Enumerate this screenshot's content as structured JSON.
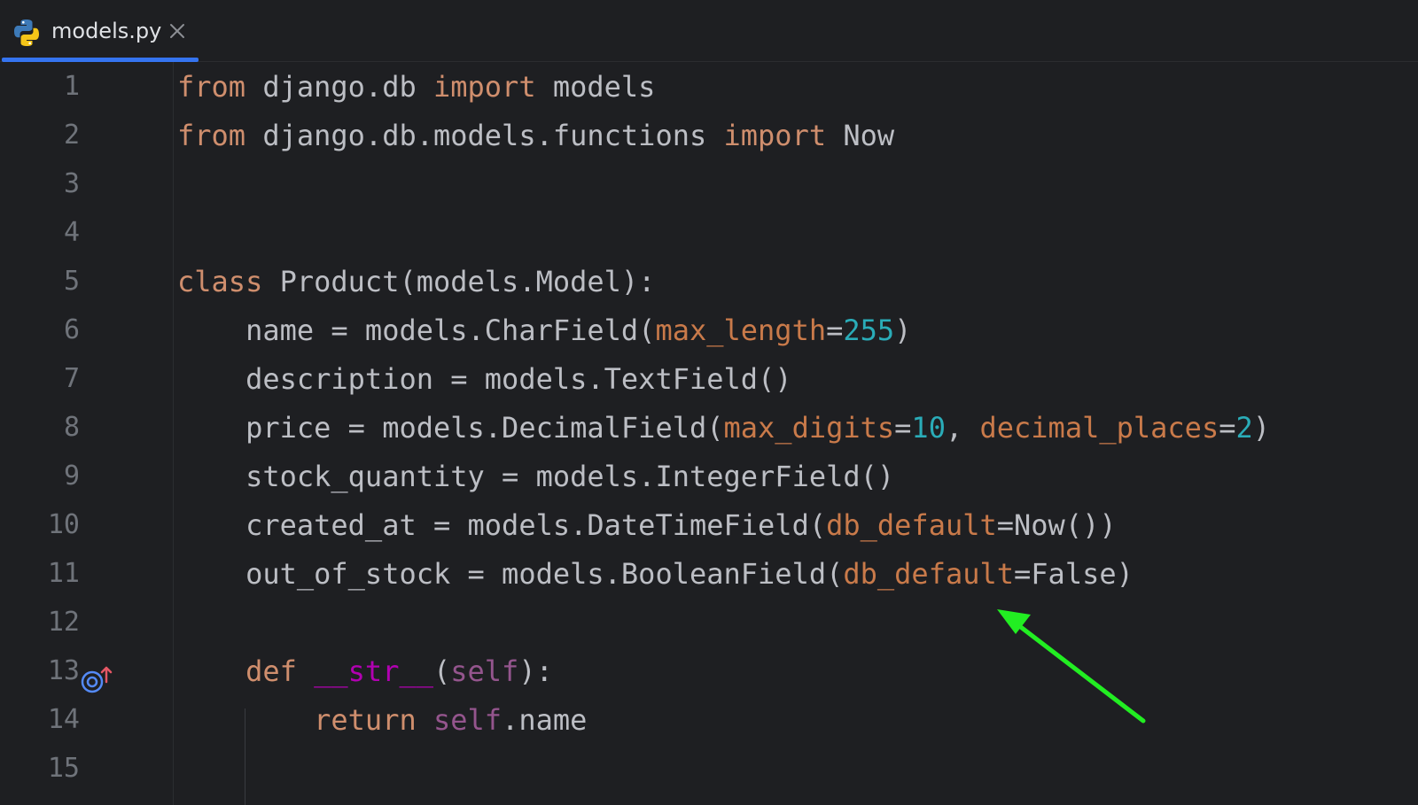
{
  "tab": {
    "filename": "models.py",
    "icon": "python-file-icon",
    "close_icon": "close-icon",
    "accent_color": "#3574f0"
  },
  "editor": {
    "line_numbers": [
      "1",
      "2",
      "3",
      "4",
      "5",
      "6",
      "7",
      "8",
      "9",
      "10",
      "11",
      "12",
      "13",
      "14",
      "15"
    ],
    "colors": {
      "background": "#1e1f22",
      "keyword": "#cf8e6d",
      "parameter": "#c97a4a",
      "number": "#2aacb8",
      "text": "#bcbec4",
      "dunder": "#b200b2",
      "self": "#94558d",
      "annotation_arrow": "#22ee22"
    },
    "lines": {
      "l1": {
        "kw1": "from",
        "t1": " django.db ",
        "kw2": "import",
        "t2": " models"
      },
      "l2": {
        "kw1": "from",
        "t1": " django.db.models.functions ",
        "kw2": "import",
        "t2": " Now"
      },
      "l5": {
        "kw1": "class",
        "t1": " Product(models.Model):"
      },
      "l6": {
        "t1": "    name = models.CharField(",
        "p1": "max_length",
        "t2": "=",
        "n1": "255",
        "t3": ")"
      },
      "l7": {
        "t1": "    description = models.TextField()"
      },
      "l8": {
        "t1": "    price = models.DecimalField(",
        "p1": "max_digits",
        "t2": "=",
        "n1": "10",
        "t3": ", ",
        "p2": "decimal_places",
        "t4": "=",
        "n2": "2",
        "t5": ")"
      },
      "l9": {
        "t1": "    stock_quantity = models.IntegerField()"
      },
      "l10": {
        "t1": "    created_at = models.DateTimeField(",
        "p1": "db_default",
        "t2": "=Now())"
      },
      "l11": {
        "t1": "    out_of_stock = models.BooleanField(",
        "p1": "db_default",
        "t2": "=False)"
      },
      "l13": {
        "t0": "    ",
        "kw1": "def",
        "t1": " ",
        "d1": "__str__",
        "t2": "(",
        "s1": "self",
        "t3": "):"
      },
      "l14": {
        "t0": "        ",
        "kw1": "return",
        "t1": " ",
        "s1": "self",
        "t2": ".name"
      }
    },
    "gutter_icon": "overrides-method-icon"
  }
}
